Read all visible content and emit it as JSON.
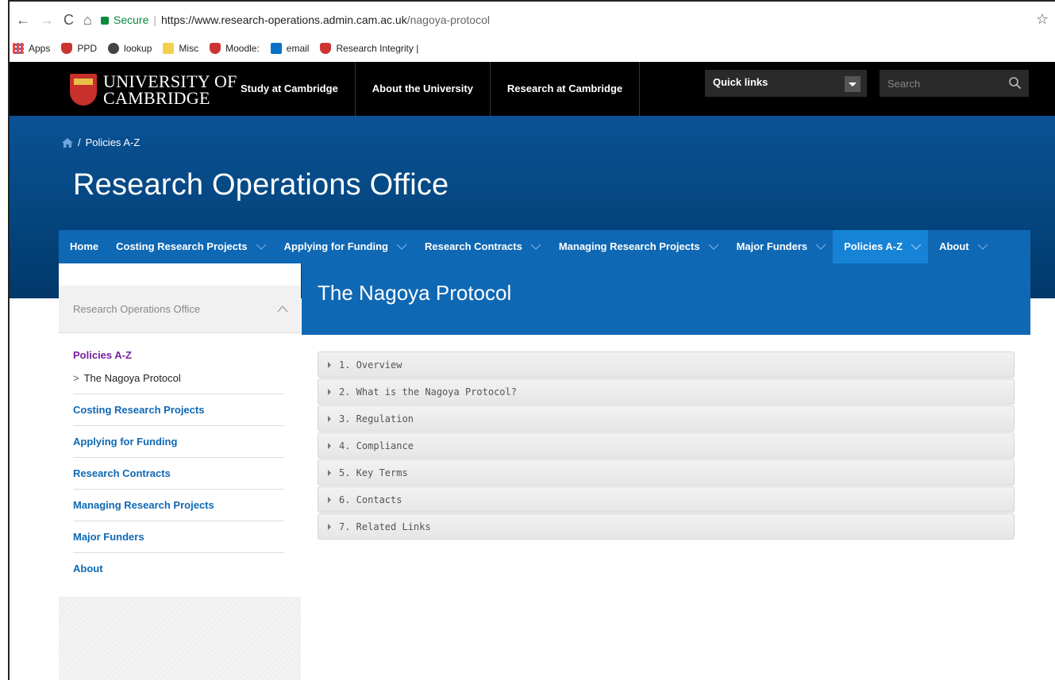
{
  "browser": {
    "secure_label": "Secure",
    "url_host": "https://www.research-operations.admin.cam.ac.uk",
    "url_path": "/nagoya-protocol",
    "bookmarks": [
      {
        "label": "Apps",
        "icon": "apps-grid-icon"
      },
      {
        "label": "PPD",
        "icon": "cambridge-crest-icon"
      },
      {
        "label": "lookup",
        "icon": "lookup-icon"
      },
      {
        "label": "Misc",
        "icon": "folder-icon"
      },
      {
        "label": "Moodle:",
        "icon": "cambridge-crest-icon"
      },
      {
        "label": "email",
        "icon": "outlook-icon"
      },
      {
        "label": "Research Integrity |",
        "icon": "cambridge-crest-icon"
      }
    ]
  },
  "header": {
    "logo_line1": "UNIVERSITY OF",
    "logo_line2": "CAMBRIDGE",
    "nav": [
      "Study at Cambridge",
      "About the University",
      "Research at Cambridge"
    ],
    "quick_links": "Quick links",
    "search_placeholder": "Search"
  },
  "site": {
    "breadcrumb": "Policies A-Z",
    "title": "Research Operations Office",
    "menu": [
      {
        "label": "Home",
        "dropdown": false,
        "active": false
      },
      {
        "label": "Costing Research Projects",
        "dropdown": true,
        "active": false
      },
      {
        "label": "Applying for Funding",
        "dropdown": true,
        "active": false
      },
      {
        "label": "Research Contracts",
        "dropdown": true,
        "active": false
      },
      {
        "label": "Managing Research Projects",
        "dropdown": true,
        "active": false
      },
      {
        "label": "Major Funders",
        "dropdown": true,
        "active": false
      },
      {
        "label": "Policies A-Z",
        "dropdown": true,
        "active": true
      },
      {
        "label": "About",
        "dropdown": true,
        "active": false
      }
    ]
  },
  "sidebar": {
    "heading": "Research Operations Office",
    "current_section": "Policies A-Z",
    "current_page": "The Nagoya Protocol",
    "items": [
      "Costing Research Projects",
      "Applying for Funding",
      "Research Contracts",
      "Managing Research Projects",
      "Major Funders",
      "About"
    ]
  },
  "page": {
    "title": "The Nagoya Protocol",
    "sections": [
      "1. Overview",
      "2. What is the Nagoya Protocol?",
      "3. Regulation",
      "4. Compliance",
      "5. Key Terms",
      "6. Contacts",
      "7. Related Links"
    ]
  },
  "colors": {
    "brand_blue": "#0f68b4",
    "active_blue": "#1683d6",
    "link_purple": "#7a1fa2"
  }
}
